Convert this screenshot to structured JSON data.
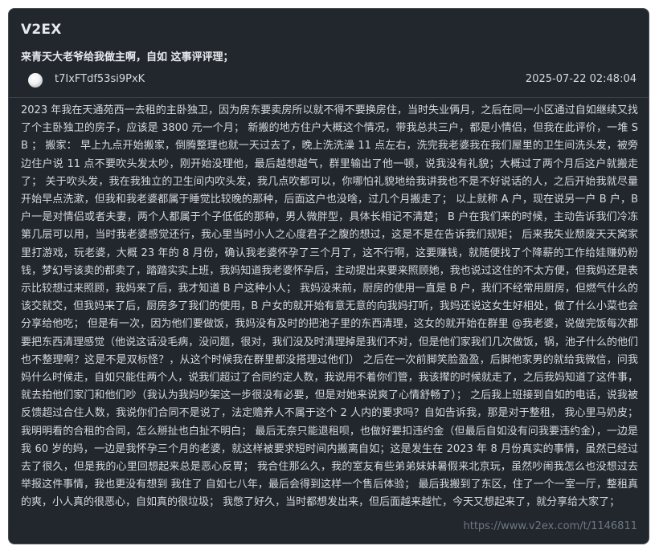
{
  "site": {
    "name": "V2EX"
  },
  "post": {
    "title": "来青天大老爷给我做主啊，自如 这事评评理；",
    "author": "t7IxFTdf53si9PxK",
    "timestamp": "2025-07-22 02:48:04",
    "content": "2023 年我在天通苑西一去租的主卧独卫，因为房东要卖房所以就不得不要换房住，当时失业俩月，之后在同一小区通过自如继续又找了个主卧独卫的房子，应该是 3800 元一个月； 新搬的地方住户大概这个情况，带我总共三户，都是小情侣，但我在此评价，一堆 SB ； 搬家： 早上九点开始搬家，倒腾整理也就一天过去了，晚上洗洗澡 11 点左右，洗完我老婆我在我们屋里的卫生间洗头发，被旁边住户说 11 点不要吹头发太吵，刚开始没理他，最后越想越气，群里输出了他一顿，说我没有礼貌；大概过了两个月后这户就搬走了； 关于吹头发，我在我独立的卫生间内吹头发，我几点吹都可以，你哪怕礼貌地给我讲我也不是不好说话的人，之后开始我就尽量开始早点洗漱，但我和我老婆都属于睡觉比较晚的那种，后面这户也没啥，过几个月搬走了； 以上就称 A 户，现在说另一户 B 户，B 户一是对情侣或者夫妻，两个人都属于个子低低的那种，男人微胖型，具体长相记不清楚； B 户在我们来的时候，主动告诉我们冷冻第几层可以用，当时我老婆感觉还行，我心里当时小人之心度君子之腹的想过，这是不是在告诉我们规矩； 后来我失业颓废天天窝家里打游戏，玩老婆，大概 23 年的 8 月份，确认我老婆怀孕了三个月了，这不行啊，这要赚钱，就随便找了个降薪的工作给娃赚奶粉钱，梦幻号该卖的都卖了，踏踏实实上班，我妈知道我老婆怀孕后，主动提出来要来照顾她，我也说过这住的不太方便，但我妈还是表示比较想过来照顾，我妈来了后，我才知道 B 户这种小人； 我妈没来前，厨房的使用一直是 B 户，我们不经常用厨房，但燃气什么的该交就交，但我妈来了后，厨房多了我们的使用，B 户女的就开始有意无意的向我妈打听，我妈还说这女生好相处，做了什么小菜也会分享给他吃； 但是有一次，因为他们要做饭，我妈没有及时的把池子里的东西清理，这女的就开始在群里 @我老婆，说做完饭每次都要把东西清理感觉（他说这话没毛病，没问题，很对，我们没及时清理掉是我们不对，但是他们家我们几次做饭，锅，池子什么的他们也不整理啊？这是不是双标怪？，从这个时候我在群里都没搭理过他们） 之后在一次前脚笑脸盈盈，后脚他家男的就给我微信，问我妈什么时候走，自如只能住两个人，说我们超过了合同约定人数，我说用不着你们管，我该撵的时候就走了，之后我妈知道了这件事，就去拍他们家门和他们吵（我认为我妈吵架这一步很没有必要，但是对她来说爽了心情舒畅了）； 之后我上班接到自如的电话，说我被反馈超过合住人数，我说你们合同不是说了，法定赡养人不属于这个 2 人内的要求吗？自如告诉我，那是对于整租， 我心里马奶皮；我明明看的合租的合同，怎么掰扯也白扯不明白； 最后无奈只能退租呗，也做好要扣违约金（但最后自如没有问我要违约金），一边是我 60 岁的妈，一边是我怀孕三个月的老婆，就这样被要求短时间内搬离自如；这是发生在 2023 年 8 月份真实的事情，虽然已经过去了很久，但是我的心里回想起来总是恶心反胃； 我合住那么久，我的室友有些弟弟妹妹暑假来北京玩，虽然吵闹我怎么也没想过去举报这件事情，我也更没有想到 我住了 自如七八年，最后会得到这样一个售后体验； 最后我搬到了东区，住了一个一室一厅，整租真的爽，小人真的很恶心，自如真的很垃圾； 我憋了好久，当时都想发出来，但后面越来越忙，今天又想起来了，就分享给大家了；"
  },
  "footer": {
    "source_url": "https://www.v2ex.com/t/1146811"
  }
}
